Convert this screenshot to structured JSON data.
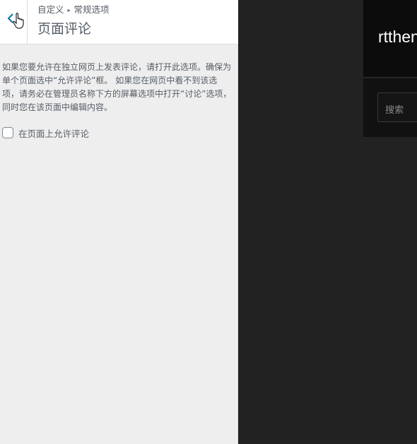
{
  "sidebar": {
    "breadcrumb": {
      "parent": "自定义",
      "current": "常规选项"
    },
    "section_title": "页面评论",
    "description": "如果您要允许在独立网页上发表评论，请打开此选项。确保为单个页面选中“允许评论”框。 如果您在网页中看不到该选项，请务必在管理员名称下方的屏幕选项中打开“讨论”选项，同时您在该页面中编辑内容。",
    "checkbox": {
      "label": "在页面上允许评论",
      "checked": false
    }
  },
  "preview": {
    "site_title": "rtthen",
    "search": {
      "placeholder": "搜索"
    }
  }
}
